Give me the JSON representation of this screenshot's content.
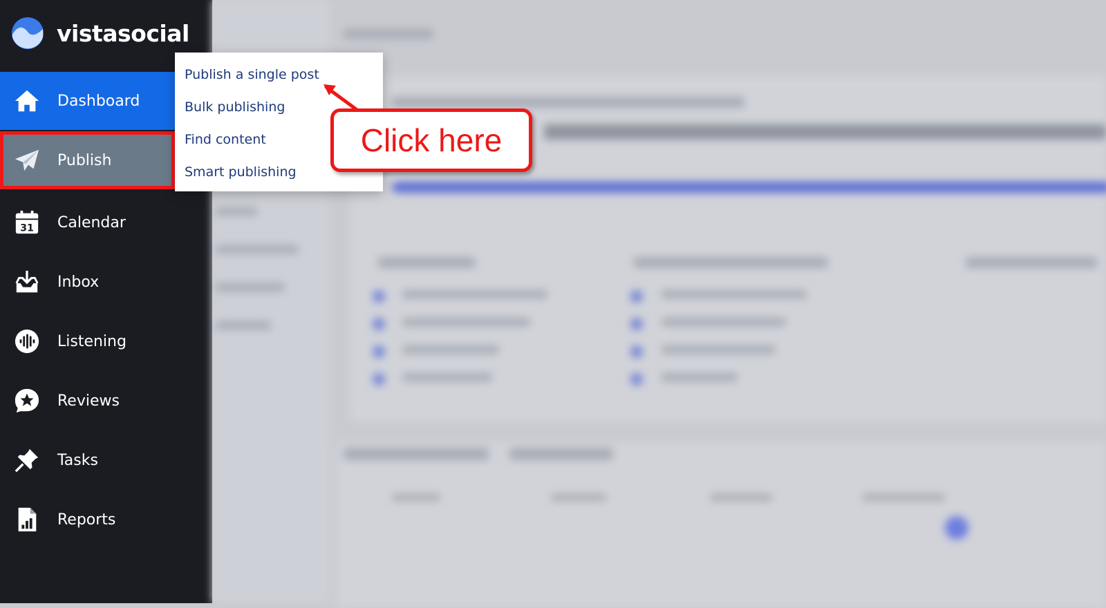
{
  "brand": {
    "name": "vistasocial",
    "logo_icon": "wave-circle-icon"
  },
  "sidebar": {
    "items": [
      {
        "id": "dashboard",
        "label": "Dashboard",
        "icon": "home-icon",
        "active": true
      },
      {
        "id": "publish",
        "label": "Publish",
        "icon": "paper-plane-icon",
        "highlighted": true
      },
      {
        "id": "calendar",
        "label": "Calendar",
        "icon": "calendar-icon",
        "badge": "31"
      },
      {
        "id": "inbox",
        "label": "Inbox",
        "icon": "inbox-icon"
      },
      {
        "id": "listening",
        "label": "Listening",
        "icon": "soundwave-icon"
      },
      {
        "id": "reviews",
        "label": "Reviews",
        "icon": "star-badge-icon"
      },
      {
        "id": "tasks",
        "label": "Tasks",
        "icon": "pushpin-icon"
      },
      {
        "id": "reports",
        "label": "Reports",
        "icon": "report-chart-icon"
      }
    ]
  },
  "publish_menu": {
    "items": [
      {
        "label": "Publish a single post"
      },
      {
        "label": "Bulk publishing"
      },
      {
        "label": "Find content"
      },
      {
        "label": "Smart publishing"
      }
    ]
  },
  "annotation": {
    "text": "Click here"
  },
  "colors": {
    "sidebar_bg": "#1a1c22",
    "active_blue": "#1469e6",
    "highlight_red": "#ef1717",
    "menu_text": "#1d3a7a"
  }
}
